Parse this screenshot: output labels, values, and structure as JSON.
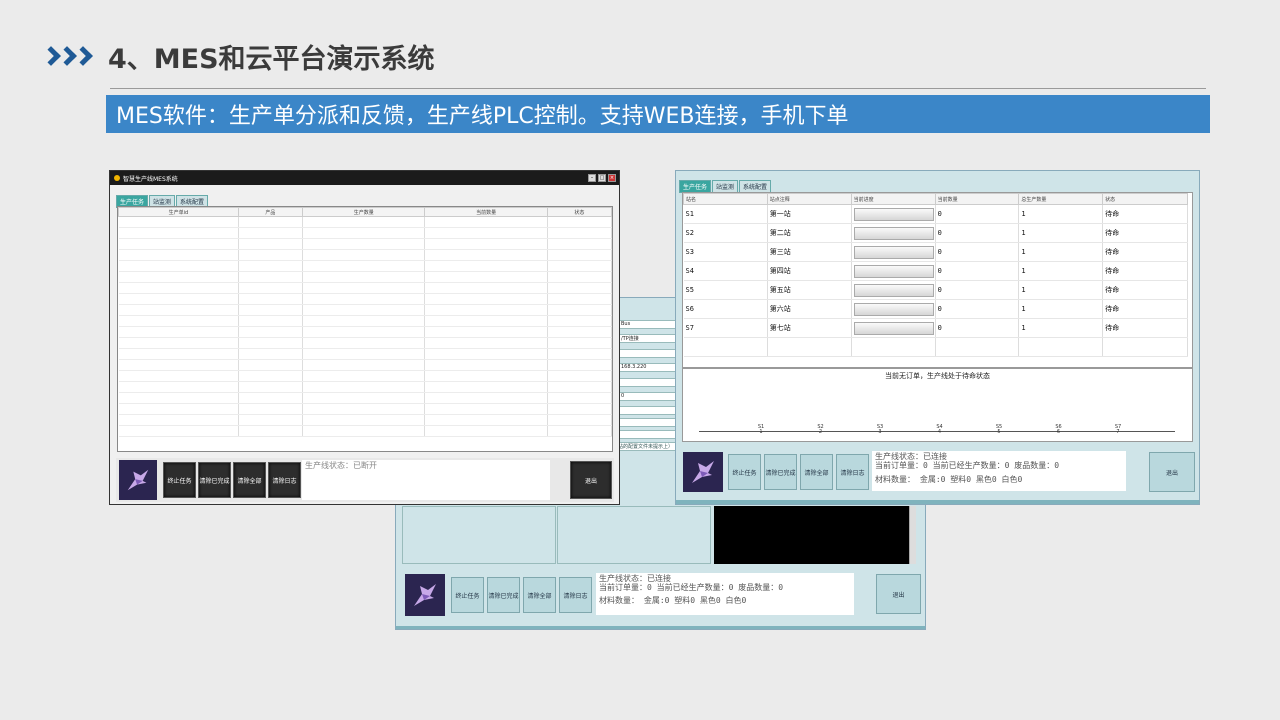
{
  "slide": {
    "title": "4、MES和云平台演示系统",
    "banner": "MES软件：生产单分派和反馈，生产线PLC控制。支持WEB连接，手机下单"
  },
  "win1": {
    "title": "智慧生产线MES系统",
    "tabs": [
      "生产任务",
      "站监测",
      "系统配置"
    ],
    "columns": [
      "生产单id",
      "产品",
      "生产数量",
      "当前数量",
      "状态"
    ],
    "buttons": [
      "终止任务",
      "清除已完成",
      "清除全部",
      "清除日志"
    ],
    "status": "生产线状态：已断开",
    "exit": "退出"
  },
  "win2": {
    "fields": [
      "Bus",
      "/TP连接",
      "",
      "168.3.220",
      "",
      "0"
    ],
    "note": "站的配置文件未提示上）",
    "buttons": [
      "终止任务",
      "清除已完成",
      "清除全部",
      "清除日志"
    ],
    "status_lines": [
      "生产线状态：已连接",
      "当前订单量：0  当前已经生产数量：0  废品数量：0",
      "材料数量：  金属:0 塑料0 黑色0 白色0"
    ],
    "exit": "退出"
  },
  "win3": {
    "tabs": [
      "生产任务",
      "站监测",
      "系统配置"
    ],
    "columns": [
      "站名",
      "站点注释",
      "当前进度",
      "当前数量",
      "总生产数量",
      "状态"
    ],
    "rows": [
      {
        "id": "S1",
        "name": "第一站",
        "progress": 0,
        "cur": "0",
        "total": "1",
        "state": "待命"
      },
      {
        "id": "S2",
        "name": "第二站",
        "progress": 0,
        "cur": "0",
        "total": "1",
        "state": "待命"
      },
      {
        "id": "S3",
        "name": "第三站",
        "progress": 0,
        "cur": "0",
        "total": "1",
        "state": "待命"
      },
      {
        "id": "S4",
        "name": "第四站",
        "progress": 0,
        "cur": "0",
        "total": "1",
        "state": "待命"
      },
      {
        "id": "S5",
        "name": "第五站",
        "progress": 0,
        "cur": "0",
        "total": "1",
        "state": "待命"
      },
      {
        "id": "S6",
        "name": "第六站",
        "progress": 0,
        "cur": "0",
        "total": "1",
        "state": "待命"
      },
      {
        "id": "S7",
        "name": "第七站",
        "progress": 0,
        "cur": "0",
        "total": "1",
        "state": "待命"
      }
    ],
    "message": "当前无订单，生产线处于待命状态",
    "station_marks": [
      {
        "code": "S1",
        "num": "1"
      },
      {
        "code": "S2",
        "num": "2"
      },
      {
        "code": "S3",
        "num": "3"
      },
      {
        "code": "S4",
        "num": "4"
      },
      {
        "code": "S5",
        "num": "5"
      },
      {
        "code": "S6",
        "num": "6"
      },
      {
        "code": "S7",
        "num": "7"
      }
    ],
    "buttons": [
      "终止任务",
      "清除已完成",
      "清除全部",
      "清除日志"
    ],
    "status_lines": [
      "生产线状态：已连接",
      "当前订单量：0  当前已经生产数量：0  废品数量：0",
      "材料数量：  金属:0 塑料0 黑色0 白色0"
    ],
    "exit": "退出"
  },
  "colors": {
    "banner": "#3b86c8",
    "chevron": "#1f5a96",
    "teal_window": "#cfe4e8",
    "active_tab": "#3aa6a0"
  }
}
